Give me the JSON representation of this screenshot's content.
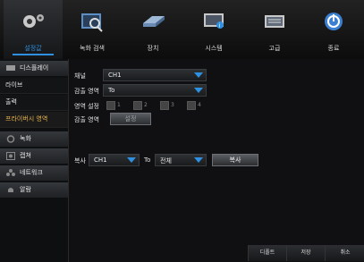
{
  "top_nav": [
    {
      "label": "설정값",
      "icon": "gear-icon",
      "active": true
    },
    {
      "label": "녹화 검색",
      "icon": "magnifier-icon",
      "active": false
    },
    {
      "label": "장치",
      "icon": "hard-drive-icon",
      "active": false
    },
    {
      "label": "시스템",
      "icon": "monitor-icon",
      "active": false
    },
    {
      "label": "고급",
      "icon": "advanced-panel-icon",
      "active": false
    },
    {
      "label": "종료",
      "icon": "power-icon",
      "active": false
    }
  ],
  "sidebar": {
    "display": "디스플레이",
    "live": "라이브",
    "output": "출력",
    "privacy_zone": "프라이버시 영역",
    "record": "녹화",
    "capture": "캡쳐",
    "network": "네트워크",
    "alarm": "알람"
  },
  "form": {
    "channel_label": "채널",
    "channel_value": "CH1",
    "mask_area_label": "감출 영역",
    "mask_area_value": "To",
    "area_setting_label": "영역 설정",
    "area_checkboxes": [
      "1",
      "2",
      "3",
      "4"
    ],
    "mask_area2_label": "감출 영역",
    "setting_button": "설정",
    "copy_label": "복사",
    "copy_from": "CH1",
    "copy_to_label": "To",
    "copy_to_value": "전체",
    "copy_button": "복사"
  },
  "footer": {
    "default_button": "디폴트",
    "save_button": "저장",
    "cancel_button": "취소"
  },
  "colors": {
    "accent": "#2f8fe0",
    "selected": "#e8b34a"
  }
}
